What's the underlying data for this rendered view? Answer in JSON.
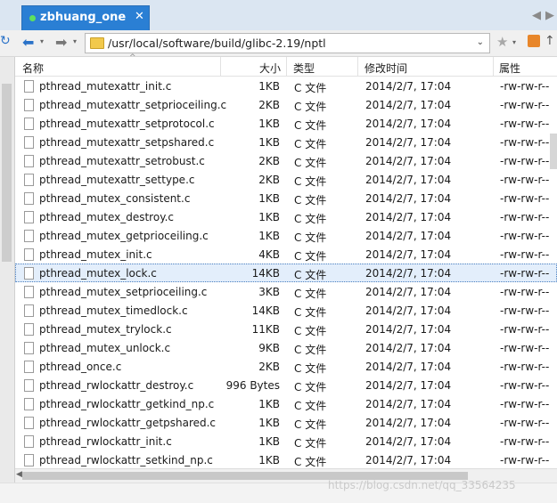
{
  "tab": {
    "title": "zbhuang_one",
    "close": "✕"
  },
  "tab_scroll": {
    "left": "◀",
    "right": "▶"
  },
  "toolbar": {
    "refresh_icon": "↻",
    "back_icon": "⬅",
    "forward_icon": "➡",
    "dropdown_icon": "▾",
    "path": "/usr/local/software/build/glibc-2.19/nptl",
    "path_dropdown": "⌄",
    "star_icon": "★",
    "up_icon": "↑"
  },
  "columns": {
    "name": "名称",
    "size": "大小",
    "type": "类型",
    "modified": "修改时间",
    "attributes": "属性",
    "sort_indicator": "^"
  },
  "rows": [
    {
      "name": "pthread_mutexattr_init.c",
      "size": "1KB",
      "type": "C 文件",
      "modified": "2014/2/7, 17:04",
      "attr": "-rw-rw-r--"
    },
    {
      "name": "pthread_mutexattr_setprioceiling.c",
      "size": "2KB",
      "type": "C 文件",
      "modified": "2014/2/7, 17:04",
      "attr": "-rw-rw-r--"
    },
    {
      "name": "pthread_mutexattr_setprotocol.c",
      "size": "1KB",
      "type": "C 文件",
      "modified": "2014/2/7, 17:04",
      "attr": "-rw-rw-r--"
    },
    {
      "name": "pthread_mutexattr_setpshared.c",
      "size": "1KB",
      "type": "C 文件",
      "modified": "2014/2/7, 17:04",
      "attr": "-rw-rw-r--"
    },
    {
      "name": "pthread_mutexattr_setrobust.c",
      "size": "2KB",
      "type": "C 文件",
      "modified": "2014/2/7, 17:04",
      "attr": "-rw-rw-r--"
    },
    {
      "name": "pthread_mutexattr_settype.c",
      "size": "2KB",
      "type": "C 文件",
      "modified": "2014/2/7, 17:04",
      "attr": "-rw-rw-r--"
    },
    {
      "name": "pthread_mutex_consistent.c",
      "size": "1KB",
      "type": "C 文件",
      "modified": "2014/2/7, 17:04",
      "attr": "-rw-rw-r--"
    },
    {
      "name": "pthread_mutex_destroy.c",
      "size": "1KB",
      "type": "C 文件",
      "modified": "2014/2/7, 17:04",
      "attr": "-rw-rw-r--"
    },
    {
      "name": "pthread_mutex_getprioceiling.c",
      "size": "1KB",
      "type": "C 文件",
      "modified": "2014/2/7, 17:04",
      "attr": "-rw-rw-r--"
    },
    {
      "name": "pthread_mutex_init.c",
      "size": "4KB",
      "type": "C 文件",
      "modified": "2014/2/7, 17:04",
      "attr": "-rw-rw-r--"
    },
    {
      "name": "pthread_mutex_lock.c",
      "size": "14KB",
      "type": "C 文件",
      "modified": "2014/2/7, 17:04",
      "attr": "-rw-rw-r--",
      "selected": true
    },
    {
      "name": "pthread_mutex_setprioceiling.c",
      "size": "3KB",
      "type": "C 文件",
      "modified": "2014/2/7, 17:04",
      "attr": "-rw-rw-r--"
    },
    {
      "name": "pthread_mutex_timedlock.c",
      "size": "14KB",
      "type": "C 文件",
      "modified": "2014/2/7, 17:04",
      "attr": "-rw-rw-r--"
    },
    {
      "name": "pthread_mutex_trylock.c",
      "size": "11KB",
      "type": "C 文件",
      "modified": "2014/2/7, 17:04",
      "attr": "-rw-rw-r--"
    },
    {
      "name": "pthread_mutex_unlock.c",
      "size": "9KB",
      "type": "C 文件",
      "modified": "2014/2/7, 17:04",
      "attr": "-rw-rw-r--"
    },
    {
      "name": "pthread_once.c",
      "size": "2KB",
      "type": "C 文件",
      "modified": "2014/2/7, 17:04",
      "attr": "-rw-rw-r--"
    },
    {
      "name": "pthread_rwlockattr_destroy.c",
      "size": "996 Bytes",
      "type": "C 文件",
      "modified": "2014/2/7, 17:04",
      "attr": "-rw-rw-r--"
    },
    {
      "name": "pthread_rwlockattr_getkind_np.c",
      "size": "1KB",
      "type": "C 文件",
      "modified": "2014/2/7, 17:04",
      "attr": "-rw-rw-r--"
    },
    {
      "name": "pthread_rwlockattr_getpshared.c",
      "size": "1KB",
      "type": "C 文件",
      "modified": "2014/2/7, 17:04",
      "attr": "-rw-rw-r--"
    },
    {
      "name": "pthread_rwlockattr_init.c",
      "size": "1KB",
      "type": "C 文件",
      "modified": "2014/2/7, 17:04",
      "attr": "-rw-rw-r--"
    },
    {
      "name": "pthread_rwlockattr_setkind_np.c",
      "size": "1KB",
      "type": "C 文件",
      "modified": "2014/2/7, 17:04",
      "attr": "-rw-rw-r--"
    }
  ],
  "watermark": "https://blog.csdn.net/qq_33564235",
  "colors": {
    "tab": "#2a7fd4",
    "selection": "#e3eefb",
    "selection_border": "#4a7fc0",
    "tab_dot": "#5ee05e"
  }
}
